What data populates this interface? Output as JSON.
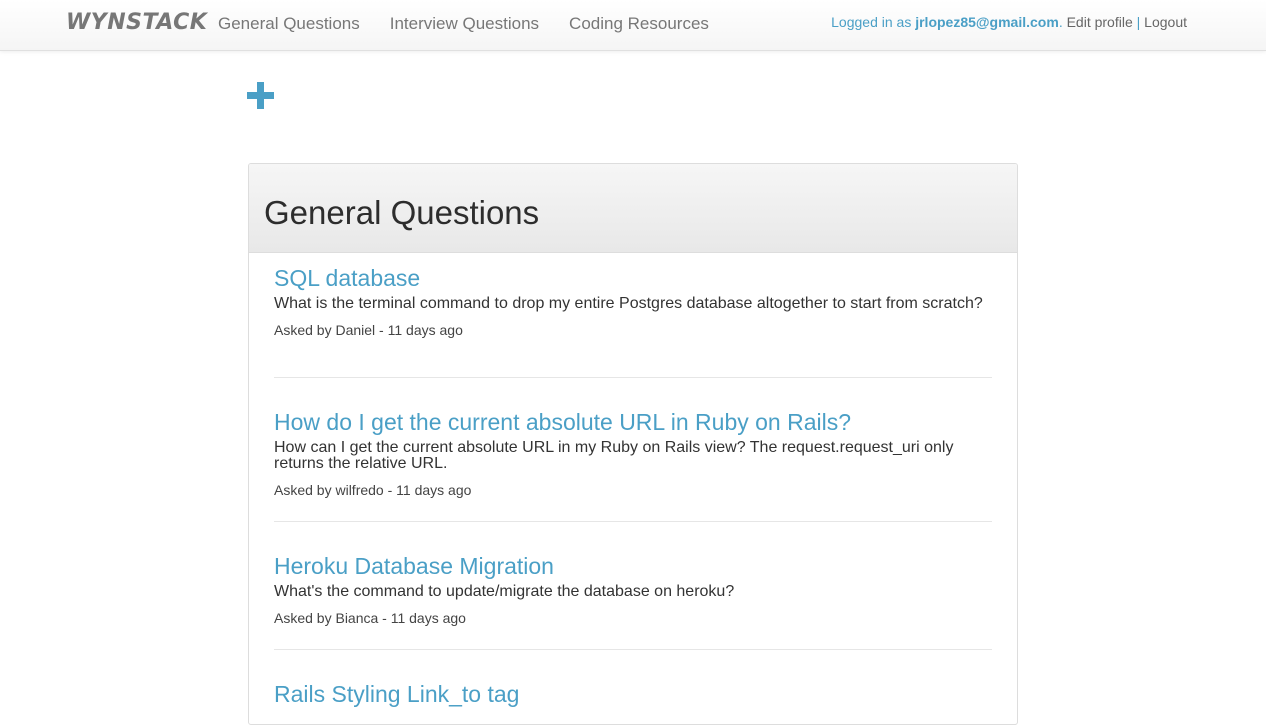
{
  "nav": {
    "brand": "WYNSTACK",
    "links": [
      {
        "label": "General Questions"
      },
      {
        "label": "Interview Questions"
      },
      {
        "label": "Coding Resources"
      }
    ],
    "logged_in_prefix": "Logged in as ",
    "email": "jrlopez85@gmail.com",
    "period": ".",
    "edit_profile": "Edit profile",
    "separator": "|",
    "logout": "Logout"
  },
  "add_icon": "plus-icon",
  "panel": {
    "heading": "General Questions",
    "questions": [
      {
        "title": "SQL database",
        "body": "What is the terminal command to drop my entire Postgres database altogether to start from scratch?",
        "meta": "Asked by Daniel - 11 days ago"
      },
      {
        "title": "How do I get the current absolute URL in Ruby on Rails?",
        "body": "How can I get the current absolute URL in my Ruby on Rails view? The request.request_uri only returns the relative URL.",
        "meta": "Asked by wilfredo - 11 days ago"
      },
      {
        "title": "Heroku Database Migration",
        "body": "What's the command to update/migrate the database on heroku?",
        "meta": "Asked by Bianca - 11 days ago"
      },
      {
        "title": "Rails Styling Link_to tag",
        "body": "",
        "meta": ""
      }
    ]
  },
  "colors": {
    "accent": "#4a9fc6",
    "brand": "#777777"
  }
}
